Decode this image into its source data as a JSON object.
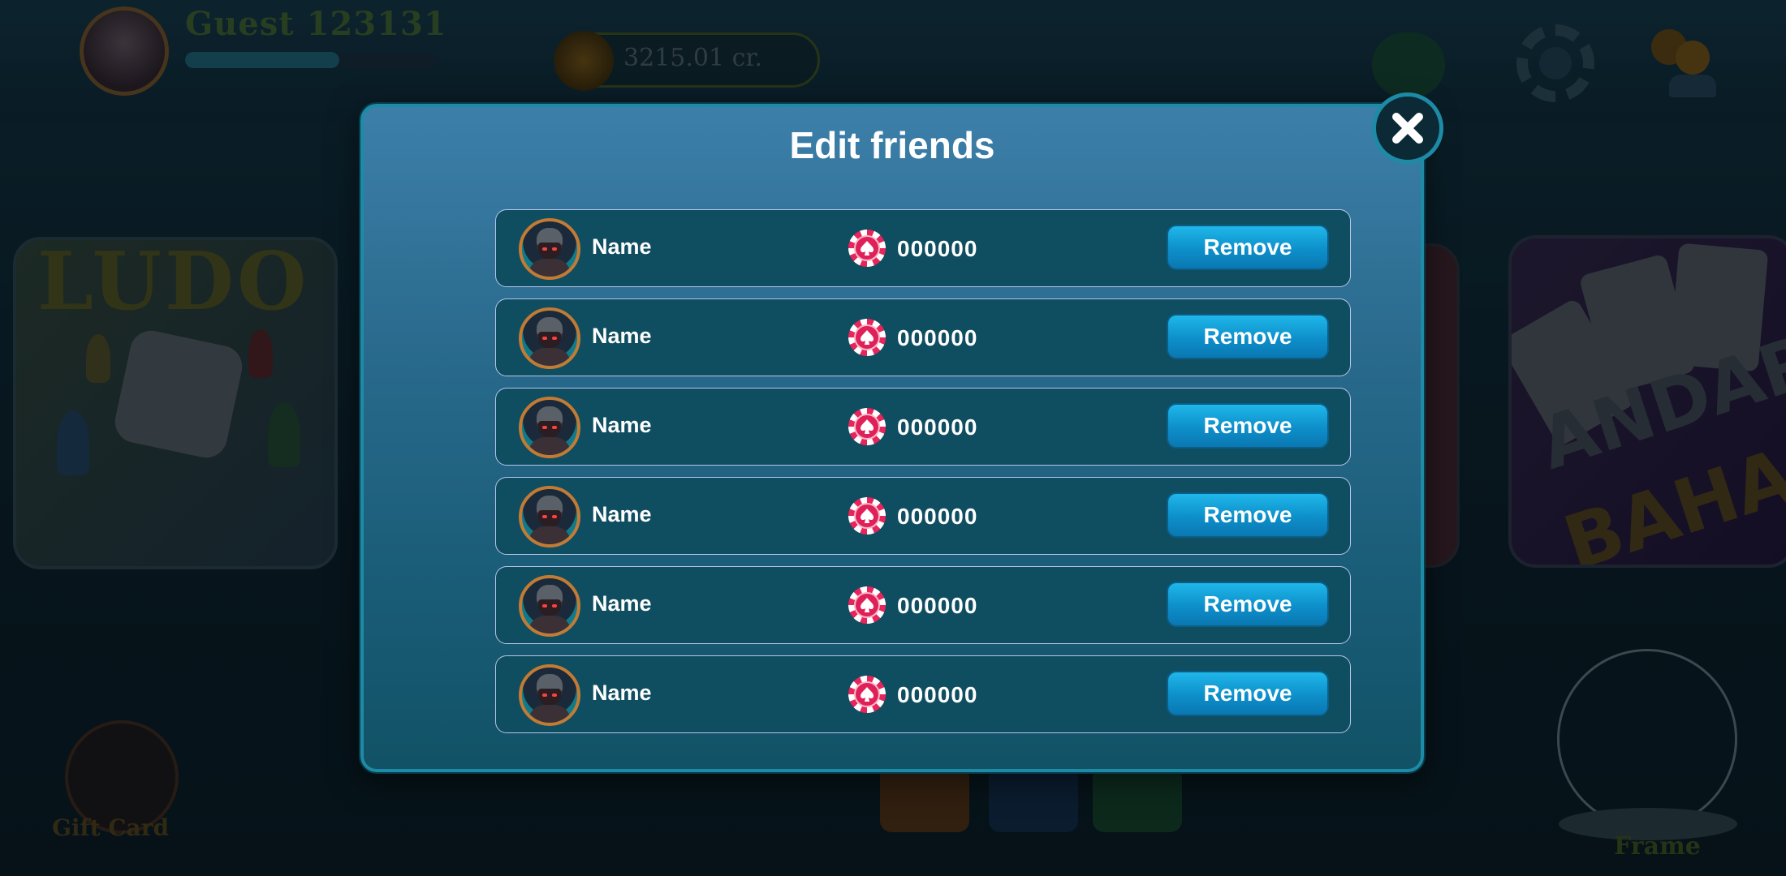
{
  "background": {
    "player_name": "Guest 123131",
    "coin_balance": "3215.01 cr.",
    "game_tiles": [
      {
        "title": "LUDO"
      },
      {
        "title_top": "ANDAR",
        "title_bottom": "BAHAR"
      }
    ],
    "gift_card_label": "Gift Card",
    "frame_label": "Frame"
  },
  "modal": {
    "title": "Edit friends",
    "close_icon": "close-icon",
    "friends": [
      {
        "name": "Name",
        "score": "000000",
        "remove_label": "Remove"
      },
      {
        "name": "Name",
        "score": "000000",
        "remove_label": "Remove"
      },
      {
        "name": "Name",
        "score": "000000",
        "remove_label": "Remove"
      },
      {
        "name": "Name",
        "score": "000000",
        "remove_label": "Remove"
      },
      {
        "name": "Name",
        "score": "000000",
        "remove_label": "Remove"
      },
      {
        "name": "Name",
        "score": "000000",
        "remove_label": "Remove"
      }
    ]
  },
  "colors": {
    "modal_border": "#1d8ba6",
    "row_bg": "#0f4d60",
    "remove_button": "#0d8fca",
    "chip": "#e8245c"
  }
}
